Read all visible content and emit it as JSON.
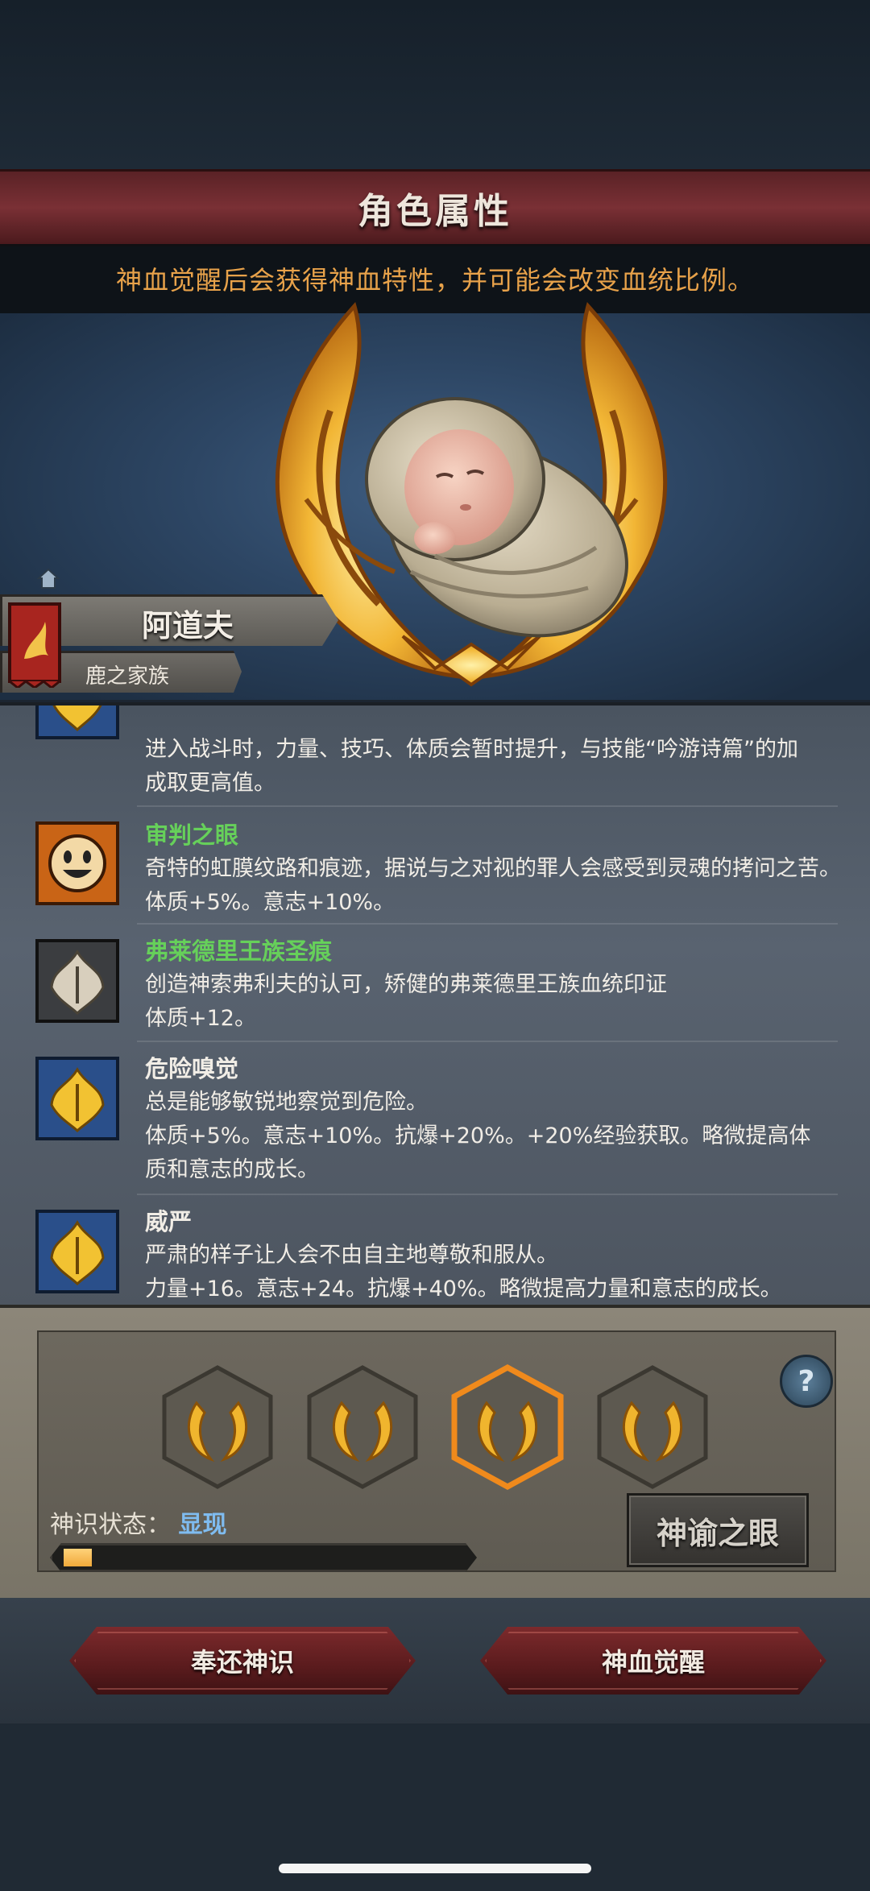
{
  "header": {
    "title": "角色属性",
    "hint": "神血觉醒后会获得神血特性，并可能会改变血统比例。"
  },
  "character": {
    "name": "阿道夫",
    "family": "鹿之家族"
  },
  "traits": [
    {
      "name": "",
      "name_color": "#f1ede6",
      "icon": "blue-gold-crest-icon",
      "lines": [
        "进入战斗时，力量、技巧、体质会暂时提升，与技能“吟游诗篇”的加",
        "成取更高值。"
      ]
    },
    {
      "name": "审判之眼",
      "name_color": "#66d05a",
      "icon": "smiling-sun-face-icon",
      "lines": [
        "奇特的虹膜纹路和痕迹，据说与之对视的罪人会感受到灵魂的拷问之苦。",
        "体质+5%。意志+10%。"
      ]
    },
    {
      "name": "弗莱德里王族圣痕",
      "name_color": "#66d05a",
      "icon": "silver-crest-icon",
      "lines": [
        "创造神索弗利夫的认可，矫健的弗莱德里王族血统印证",
        "体质+12。"
      ]
    },
    {
      "name": "危险嗅觉",
      "name_color": "#f1ede6",
      "icon": "blue-gold-crest-icon",
      "lines": [
        "总是能够敏锐地察觉到危险。",
        "体质+5%。意志+10%。抗爆+20%。+20%经验获取。略微提高体",
        "质和意志的成长。"
      ]
    },
    {
      "name": "威严",
      "name_color": "#f1ede6",
      "icon": "blue-gold-crest-icon",
      "lines": [
        "严肃的样子让人会不由自主地尊敬和服从。",
        "力量+16。意志+24。抗爆+40%。略微提高力量和意志的成长。"
      ]
    }
  ],
  "awakening": {
    "help": "?",
    "state_label": "神识状态：",
    "state_value": "显现",
    "progress": 0.07,
    "oracle_button": "神谕之眼"
  },
  "buttons": {
    "return": "奉还神识",
    "awaken": "神血觉醒"
  },
  "colors": {
    "accent_orange": "#e8a24a",
    "trait_green": "#66d05a",
    "state_blue": "#7fbcf0",
    "button_red": "#7c2a2c"
  }
}
